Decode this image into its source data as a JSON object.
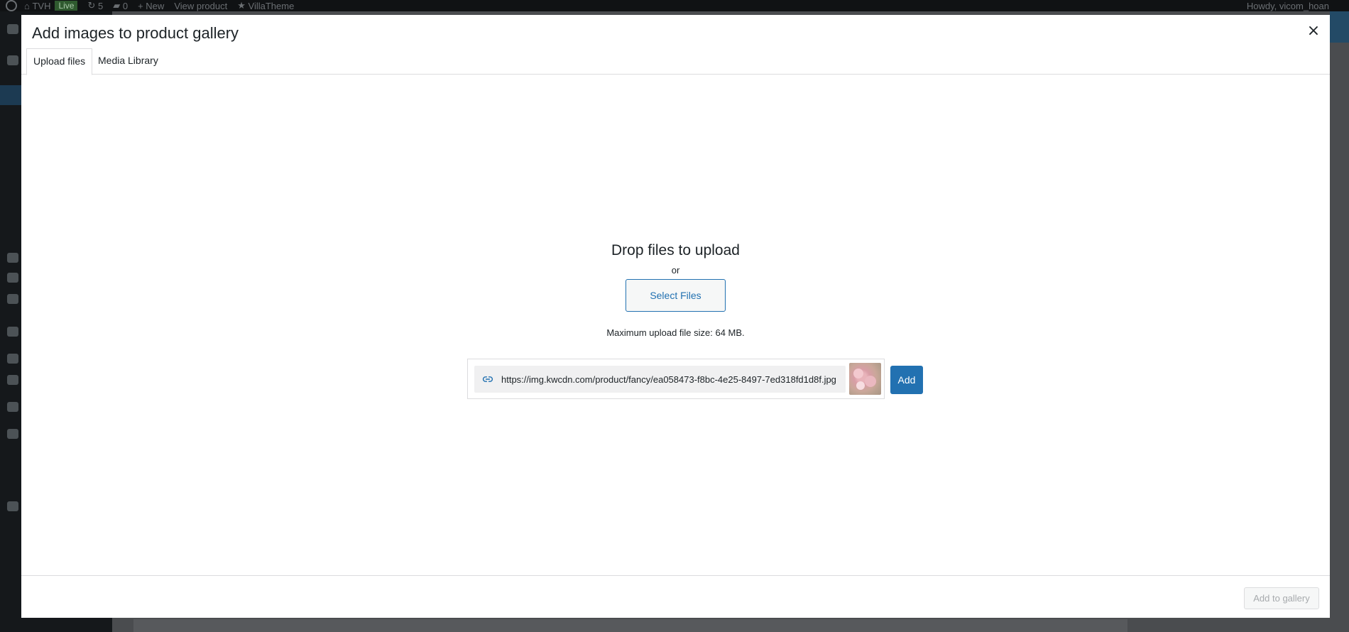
{
  "admin_bar": {
    "site_name": "TVH",
    "live_badge": "Live",
    "updates_count": "5",
    "comments_count": "0",
    "new_label": "New",
    "view_product_label": "View product",
    "plugin_label": "VillaTheme",
    "howdy": "Howdy, vicom_hoan"
  },
  "modal": {
    "title": "Add images to product gallery",
    "close_symbol": "×",
    "tabs": [
      {
        "label": "Upload files",
        "active": true
      },
      {
        "label": "Media Library",
        "active": false
      }
    ],
    "upload": {
      "drop_title": "Drop files to upload",
      "or_text": "or",
      "select_button": "Select Files",
      "max_size": "Maximum upload file size: 64 MB."
    },
    "url_import": {
      "icon": "link-icon",
      "value": "https://img.kwcdn.com/product/fancy/ea058473-f8bc-4e25-8497-7ed318fd1d8f.jpg",
      "add_button": "Add"
    },
    "footer": {
      "add_to_gallery": "Add to gallery"
    }
  },
  "colors": {
    "primary": "#2271b1",
    "border": "#dcdcde",
    "text": "#1d2327",
    "disabled_text": "#a7aaad"
  }
}
